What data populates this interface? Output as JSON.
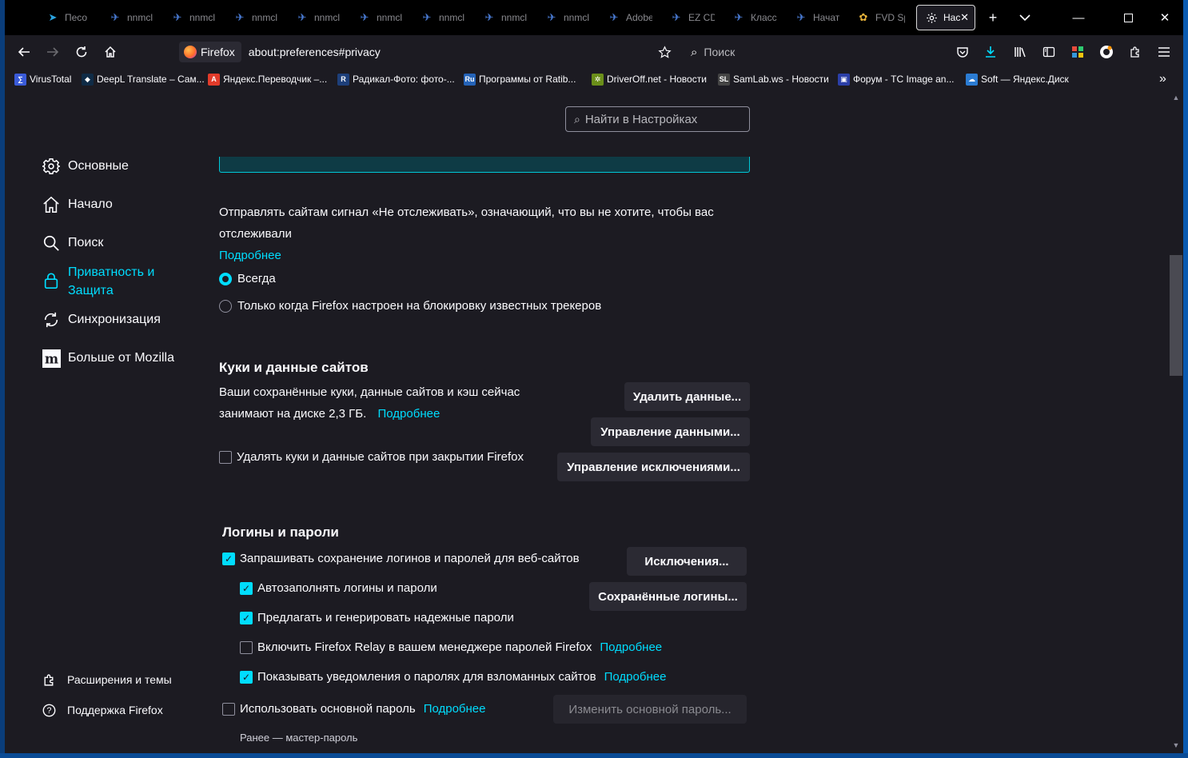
{
  "browser": {
    "tabs": [
      {
        "label": "Песо",
        "icon": "telegram-icon"
      },
      {
        "label": "nnmcl",
        "icon": "nnmclub-icon"
      },
      {
        "label": "nnmcl",
        "icon": "nnmclub-icon"
      },
      {
        "label": "nnmcl",
        "icon": "nnmclub-icon"
      },
      {
        "label": "nnmcl",
        "icon": "nnmclub-icon"
      },
      {
        "label": "nnmcl",
        "icon": "nnmclub-icon"
      },
      {
        "label": "nnmcl",
        "icon": "nnmclub-icon"
      },
      {
        "label": "nnmcl",
        "icon": "nnmclub-icon"
      },
      {
        "label": "nnmcl",
        "icon": "nnmclub-icon"
      },
      {
        "label": "Adobe",
        "icon": "nnmclub-icon"
      },
      {
        "label": "EZ CD",
        "icon": "nnmclub-icon"
      },
      {
        "label": "Класс",
        "icon": "nnmclub-icon"
      },
      {
        "label": "Начат",
        "icon": "nnmclub-icon"
      },
      {
        "label": "FVD Sp",
        "icon": "fvd-icon"
      },
      {
        "label": "Нас",
        "icon": "gear-icon",
        "active": true
      }
    ],
    "identity_label": "Firefox",
    "url": "about:preferences#privacy",
    "search_placeholder": "Поиск",
    "bookmarks": [
      {
        "label": "VirusTotal",
        "icon_text": "∑",
        "color": "#3a5bd9"
      },
      {
        "label": "DeepL Translate – Сам...",
        "icon_text": "◆",
        "color": "#0f2b46"
      },
      {
        "label": "Яндекс.Переводчик –...",
        "icon_text": "A",
        "color": "#e23b2a"
      },
      {
        "label": "Радикал-Фото: фото-...",
        "icon_text": "R",
        "color": "#1d3f7a"
      },
      {
        "label": "Программы от Ratib...",
        "icon_text": "Ru",
        "color": "#2463b8"
      },
      {
        "label": "DriverOff.net - Новости",
        "icon_text": "✲",
        "color": "#6b8f1a"
      },
      {
        "label": "SamLab.ws - Новости",
        "icon_text": "SL",
        "color": "#444444"
      },
      {
        "label": "Форум - TC Image an...",
        "icon_text": "▣",
        "color": "#2b3fa8"
      },
      {
        "label": "Soft — Яндекс.Диск",
        "icon_text": "☁",
        "color": "#2b7cd3"
      }
    ]
  },
  "settings": {
    "find_placeholder": "Найти в Настройках",
    "categories": [
      {
        "label": "Основные",
        "icon": "gear-icon"
      },
      {
        "label": "Начало",
        "icon": "home-icon"
      },
      {
        "label": "Поиск",
        "icon": "search-icon"
      },
      {
        "label_line1": "Приватность и",
        "label_line2": "Защита",
        "icon": "lock-icon",
        "selected": true
      },
      {
        "label": "Синхронизация",
        "icon": "sync-icon"
      },
      {
        "label": "Больше от Mozilla",
        "icon": "mozilla-icon"
      }
    ],
    "footer": {
      "extensions": "Расширения и темы",
      "support": "Поддержка Firefox"
    },
    "dnt": {
      "text_line1": "Отправлять сайтам сигнал «Не отслеживать», означающий, что вы не хотите, чтобы вас",
      "text_line2": "отслеживали",
      "learn_more": "Подробнее",
      "option_always": "Всегда",
      "option_only": "Только когда Firefox настроен на блокировку известных трекеров"
    },
    "cookies": {
      "title": "Куки и данные сайтов",
      "desc_line1": "Ваши сохранённые куки, данные сайтов и кэш сейчас",
      "desc_line2": "занимают на диске 2,3 ГБ.",
      "learn_more": "Подробнее",
      "btn_clear": "Удалить данные...",
      "btn_manage": "Управление данными...",
      "btn_exceptions": "Управление исключениями...",
      "delete_on_close": "Удалять куки и данные сайтов при закрытии Firefox"
    },
    "logins": {
      "title": "Логины и пароли",
      "ask_save": "Запрашивать сохранение логинов и паролей для веб-сайтов",
      "autofill": "Автозаполнять логины и пароли",
      "suggest": "Предлагать и генерировать надежные пароли",
      "relay": "Включить Firefox Relay в вашем менеджере паролей Firefox",
      "relay_link": "Подробнее",
      "breach": "Показывать уведомления о паролях для взломанных сайтов",
      "breach_link": "Подробнее",
      "primary": "Использовать основной пароль",
      "primary_link": "Подробнее",
      "btn_exceptions": "Исключения...",
      "btn_saved": "Сохранённые логины...",
      "btn_change_primary": "Изменить основной пароль...",
      "note": "Ранее — мастер-пароль"
    }
  },
  "colors": {
    "accent": "#00ddff",
    "background": "#1c1b22",
    "button": "#2b2a33",
    "tabstrip": "#000000"
  }
}
